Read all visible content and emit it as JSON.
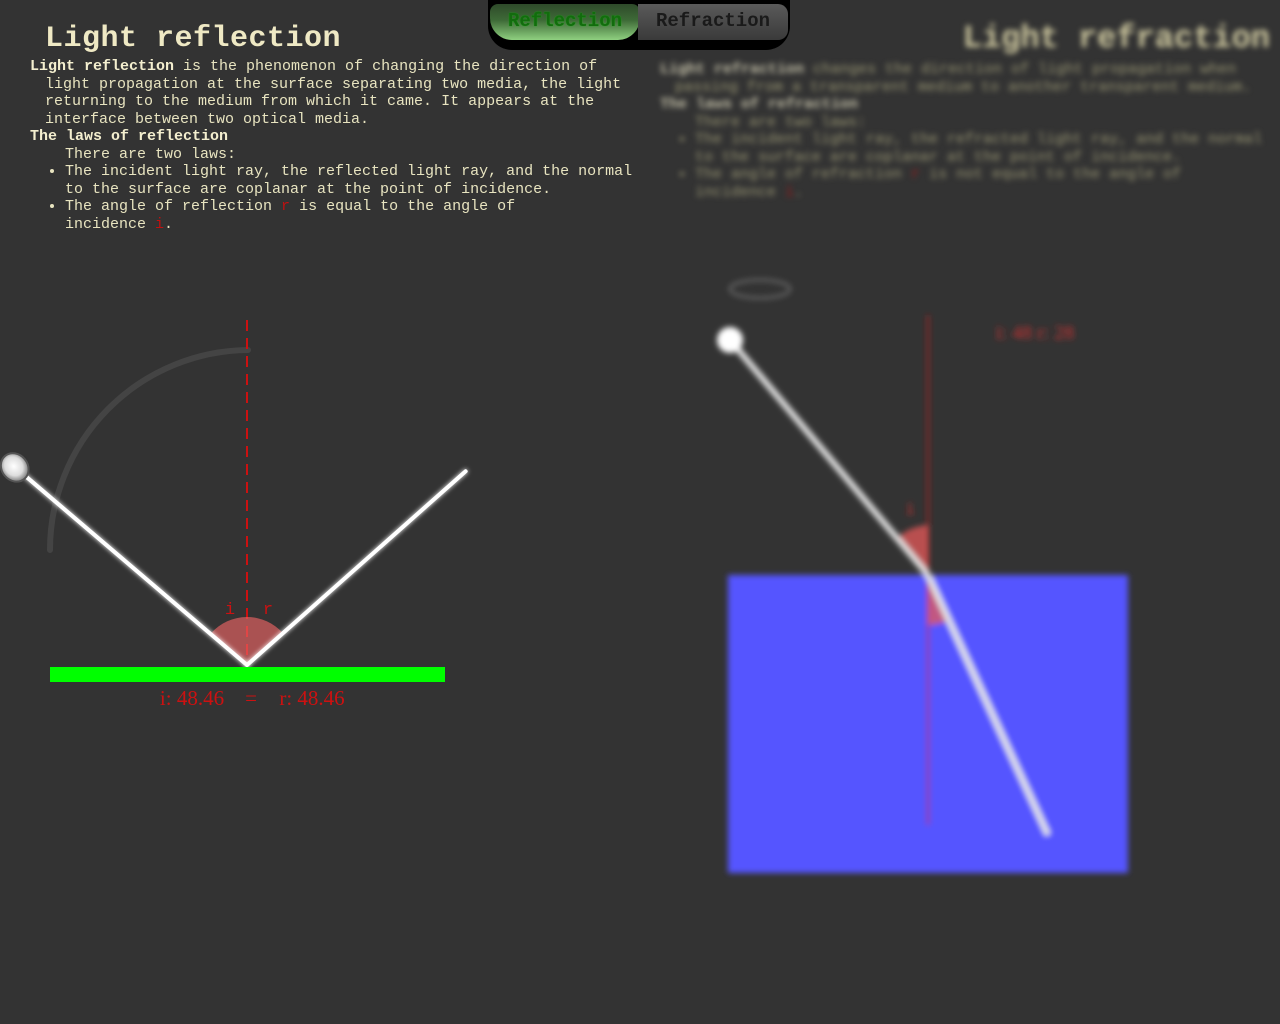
{
  "tabs": {
    "reflection_label": "Reflection",
    "refraction_label": "Refraction",
    "active": "reflection"
  },
  "reflection": {
    "title": "Light reflection",
    "intro_term": "Light reflection",
    "intro_text": " is the phenomenon of changing the direction of light propagation at the surface separating two media, the light returning to the medium from which it came. It appears at the interface between two optical media.",
    "laws_heading": "The laws of reflection",
    "laws_intro": "There are two laws:",
    "law1": "The incident light ray, the reflected light ray, and the normal to the surface are coplanar at the point of incidence.",
    "law2_a": "The angle of reflection ",
    "law2_r": "r",
    "law2_b": " is equal to the angle of",
    "law2_c": "incidence ",
    "law2_i": "i",
    "law2_d": ".",
    "angle_i_label": "i",
    "angle_r_label": "r",
    "readout_i": "i: 48.46",
    "readout_eq": "=",
    "readout_r": "r: 48.46",
    "angle_deg": 48.46
  },
  "refraction": {
    "title": "Light refraction",
    "intro_term": "Light refraction",
    "intro_text": " changes the direction of light propagation when passing from a transparent medium to another transparent medium.",
    "laws_heading": "The laws of refraction",
    "laws_intro": "There are two laws:",
    "law1": "The incident light ray, the refracted light ray, and the normal to the surface are coplanar at the point of incidence.",
    "law2_a": "The angle of refraction ",
    "law2_r": "r",
    "law2_b": " is not equal to the angle of incidence ",
    "law2_i": "i",
    "law2_d": ".",
    "angle_i_label": "i",
    "readout": "i: 48  r: 28"
  },
  "colors": {
    "background": "#333333",
    "text": "#e8e4c0",
    "mirror": "#00ff00",
    "normal": "#cc1111",
    "water": "#5555ff",
    "ray": "#ffffff"
  }
}
